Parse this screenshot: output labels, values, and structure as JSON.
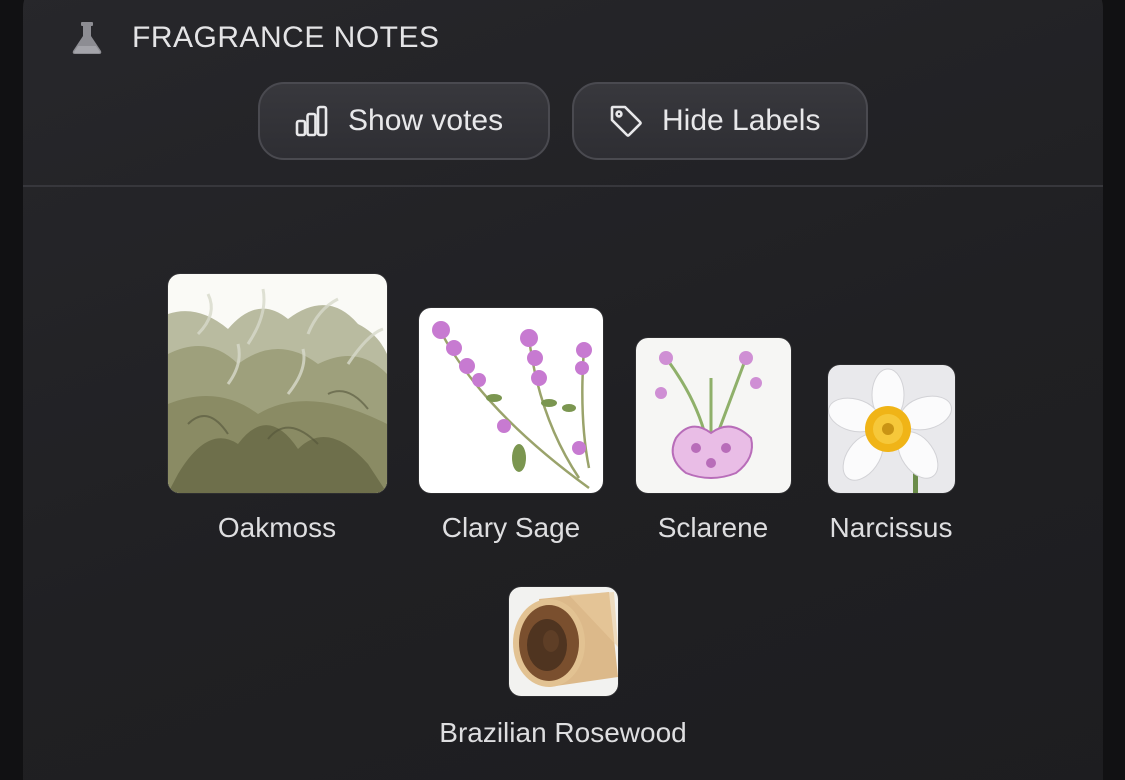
{
  "header": {
    "title": "FRAGRANCE NOTES",
    "icon": "flask-icon"
  },
  "toolbar": {
    "votes_label": "Show votes",
    "votes_icon": "bar-chart-icon",
    "labels_label": "Hide Labels",
    "labels_icon": "tag-icon"
  },
  "notes": [
    {
      "label": "Oakmoss",
      "image": "oakmoss-image"
    },
    {
      "label": "Clary Sage",
      "image": "clary-sage-image"
    },
    {
      "label": "Sclarene",
      "image": "sclarene-image"
    },
    {
      "label": "Narcissus",
      "image": "narcissus-image"
    },
    {
      "label": "Brazilian Rosewood",
      "image": "brazilian-rosewood-image"
    }
  ],
  "colors": {
    "panel": "#252528",
    "text": "#e4e4e6",
    "button_border": "#4a4a50"
  }
}
